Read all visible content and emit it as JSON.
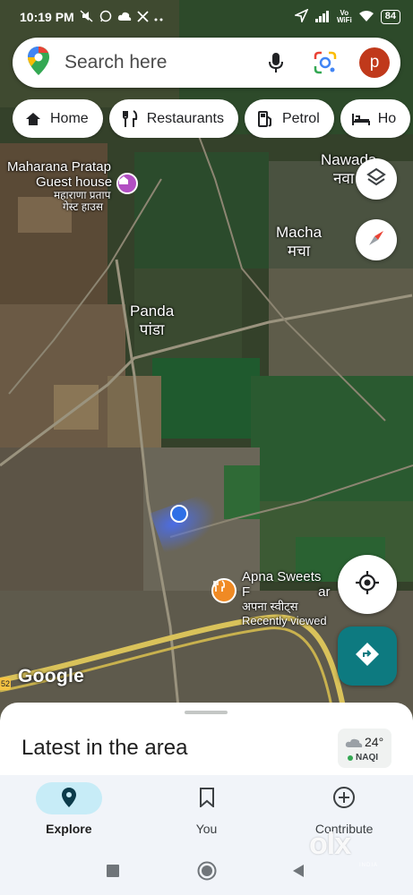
{
  "status_bar": {
    "time": "10:19 PM",
    "vo_wifi": "Vo\nWiFi",
    "battery": "84"
  },
  "search": {
    "placeholder": "Search here",
    "avatar_letter": "p"
  },
  "chips": [
    {
      "label": "Home",
      "icon": "home-icon"
    },
    {
      "label": "Restaurants",
      "icon": "restaurant-icon"
    },
    {
      "label": "Petrol",
      "icon": "fuel-icon"
    },
    {
      "label": "Ho",
      "icon": "hotel-icon"
    }
  ],
  "map": {
    "places": {
      "maharana_line1": "Maharana Pratap",
      "maharana_line2": "Guest house",
      "maharana_hindi1": "महाराणा प्रताप",
      "maharana_hindi2": "गेस्ट हाउस",
      "nawada": "Nawada",
      "nawada_hindi": "नवा",
      "macha": "Macha",
      "macha_hindi": "मचा",
      "panda": "Panda",
      "panda_hindi": "पांडा",
      "apna_sweets": "Apna Sweets F",
      "apna_sweets_tail": "ar",
      "apna_sweets_hindi": "अपना स्वीट्स",
      "recently_viewed": "Recently viewed"
    },
    "google_logo": "Google",
    "road_shield": "52"
  },
  "sheet": {
    "title": "Latest in the area",
    "weather_temp": "24°",
    "weather_aqi": "NAQI"
  },
  "bottom_nav": {
    "explore": "Explore",
    "you": "You",
    "contribute": "Contribute"
  },
  "watermark": {
    "brand": "olx",
    "sub": "INDIA"
  },
  "colors": {
    "directions_button": "#0d7a80",
    "explore_pill": "#c7ecf7",
    "avatar": "#c0391b",
    "location_dot": "#2f6fe6"
  }
}
